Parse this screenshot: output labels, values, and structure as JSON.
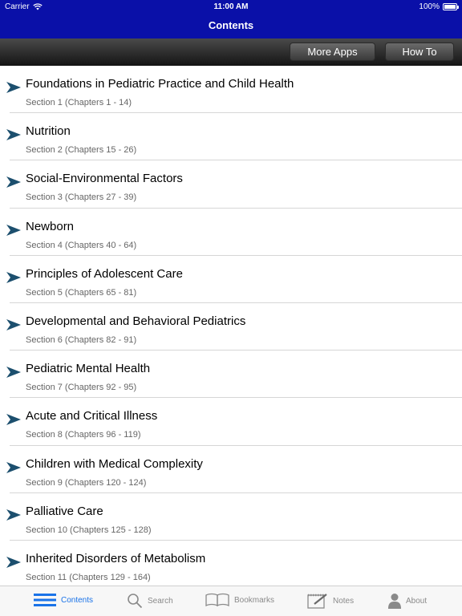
{
  "status": {
    "carrier": "Carrier",
    "time": "11:00 AM",
    "battery": "100%"
  },
  "nav": {
    "title": "Contents"
  },
  "toolbar": {
    "more_apps": "More Apps",
    "how_to": "How To"
  },
  "sections": [
    {
      "title": "Foundations in Pediatric Practice and Child Health",
      "subtitle": "Section 1 (Chapters 1 - 14)"
    },
    {
      "title": "Nutrition",
      "subtitle": "Section 2 (Chapters 15 - 26)"
    },
    {
      "title": "Social-Environmental Factors",
      "subtitle": "Section 3 (Chapters 27 - 39)"
    },
    {
      "title": "Newborn",
      "subtitle": "Section 4 (Chapters 40 - 64)"
    },
    {
      "title": "Principles of Adolescent Care",
      "subtitle": "Section 5 (Chapters 65 - 81)"
    },
    {
      "title": "Developmental and Behavioral Pediatrics",
      "subtitle": "Section 6 (Chapters 82 - 91)"
    },
    {
      "title": "Pediatric Mental Health",
      "subtitle": "Section 7 (Chapters 92 - 95)"
    },
    {
      "title": "Acute and Critical Illness",
      "subtitle": "Section 8 (Chapters 96 - 119)"
    },
    {
      "title": "Children with Medical Complexity",
      "subtitle": "Section 9 (Chapters 120 - 124)"
    },
    {
      "title": "Palliative Care",
      "subtitle": "Section 10 (Chapters 125 - 128)"
    },
    {
      "title": "Inherited Disorders of Metabolism",
      "subtitle": "Section 11 (Chapters 129 - 164)"
    }
  ],
  "tabs": [
    {
      "label": "Contents",
      "icon": "list-icon",
      "active": true
    },
    {
      "label": "Search",
      "icon": "search-icon",
      "active": false
    },
    {
      "label": "Bookmarks",
      "icon": "book-icon",
      "active": false
    },
    {
      "label": "Notes",
      "icon": "notes-icon",
      "active": false
    },
    {
      "label": "About",
      "icon": "person-icon",
      "active": false
    }
  ],
  "colors": {
    "header": "#0a10a8",
    "chevron": "#1c4f6e",
    "active_tab": "#1a73e8"
  }
}
